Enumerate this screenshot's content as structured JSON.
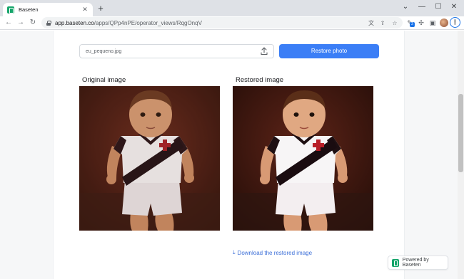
{
  "browser": {
    "tab_title": "Baseten",
    "tab_close": "✕",
    "new_tab": "+",
    "window_controls": {
      "minimize": "—",
      "maximize": "☐",
      "close": "✕",
      "tabs_menu": "⌄"
    },
    "url_host": "app.baseten.co",
    "url_path": "/apps/QPp4nPE/operator_views/RqgOnqV",
    "extension_badge": "2",
    "icons": [
      "back-arrow-icon",
      "forward-arrow-icon",
      "reload-icon",
      "lock-icon",
      "translate-icon",
      "share-icon",
      "bookmark-star-icon",
      "extension-icon",
      "puzzle-icon",
      "side-panel-icon",
      "profile-avatar",
      "kebab-menu-icon"
    ]
  },
  "form": {
    "file_name": "eu_pequeno.jpg",
    "restore_button": "Restore photo"
  },
  "images": {
    "original_label": "Original image",
    "restored_label": "Restored image"
  },
  "download": {
    "label": "Download the restored image"
  },
  "footer": {
    "powered_by": "Powered by Baseten"
  },
  "colors": {
    "accent": "#3b7ef6",
    "link": "#3c6fd8",
    "brand": "#16a56b"
  }
}
